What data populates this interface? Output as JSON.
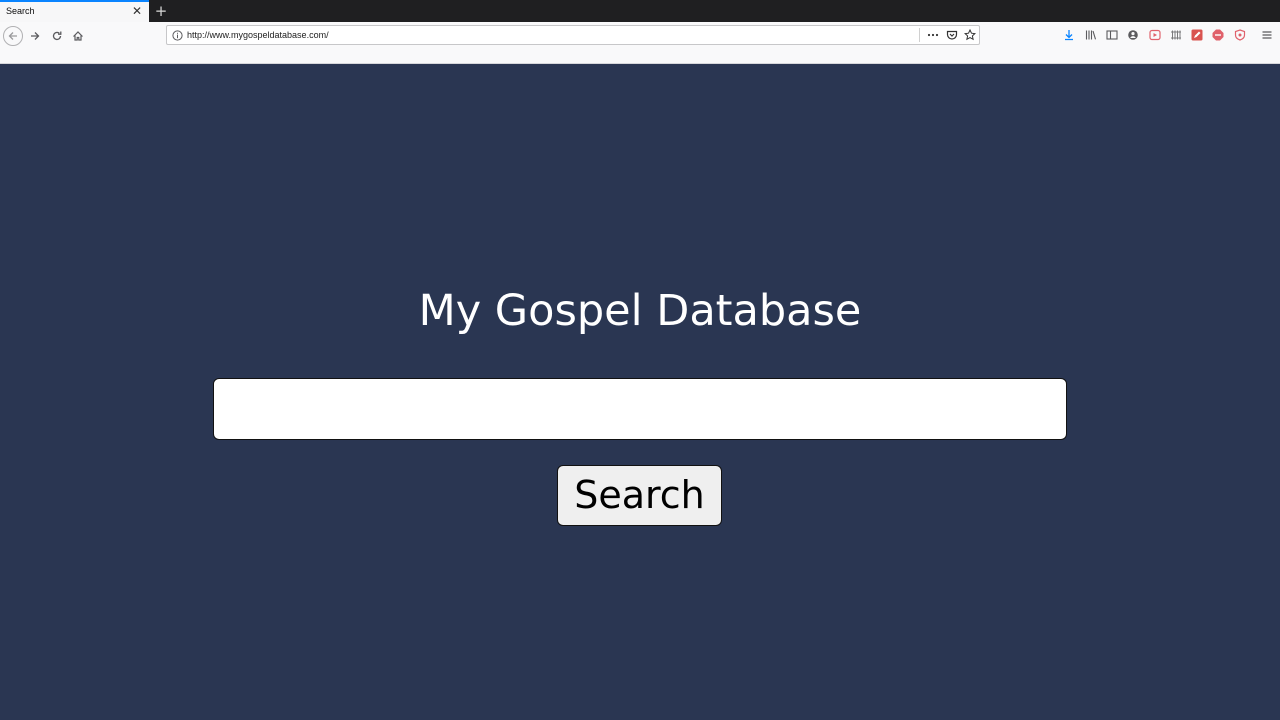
{
  "browser": {
    "tab": {
      "title": "Search",
      "close_glyph": "✕"
    },
    "new_tab_glyph": "+",
    "url": "http://www.mygospeldatabase.com/",
    "icons": {
      "back": "back-arrow-icon",
      "forward": "forward-arrow-icon",
      "reload": "reload-icon",
      "home": "home-icon",
      "info": "info-icon",
      "more": "more-dots-icon",
      "pocket": "pocket-icon",
      "bookmark": "star-icon",
      "download": "download-icon",
      "library": "library-icon",
      "sidebar": "sidebar-icon",
      "account": "account-icon",
      "menu": "hamburger-menu-icon"
    },
    "colors": {
      "accent": "#0a84ff",
      "toolbar": "#f9f9fa",
      "tabstrip": "#1f1f21"
    }
  },
  "page": {
    "title": "My Gospel Database",
    "search_value": "",
    "search_button_label": "Search",
    "colors": {
      "background": "#2a3652",
      "title": "#ffffff"
    }
  }
}
